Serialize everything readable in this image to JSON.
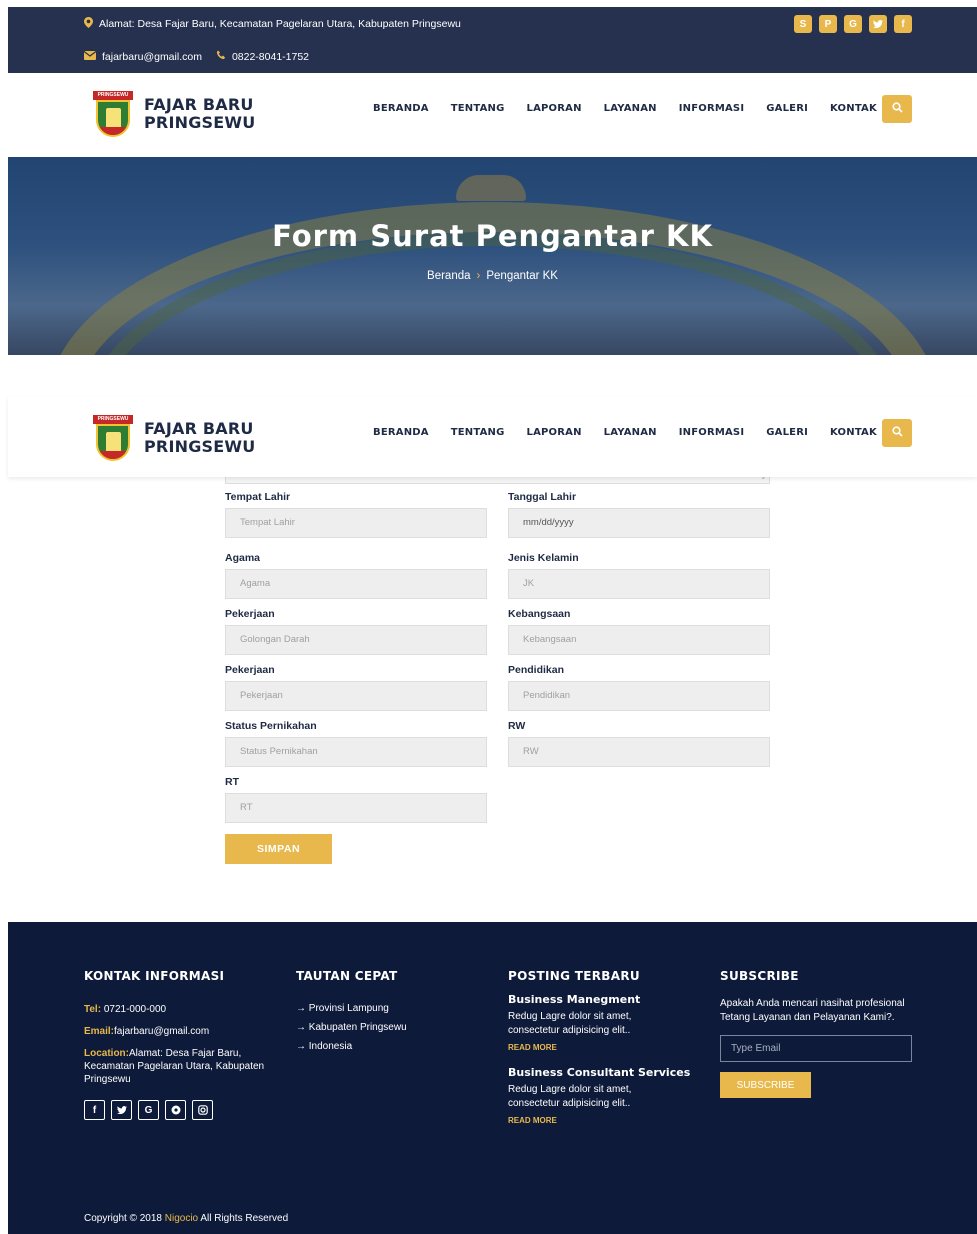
{
  "topbar": {
    "address": "Alamat: Desa Fajar Baru, Kecamatan Pagelaran Utara, Kabupaten Pringsewu",
    "email": "fajarbaru@gmail.com",
    "phone": "0822-8041-1752",
    "socials": [
      "skype-icon",
      "pinterest-icon",
      "google-icon",
      "twitter-icon",
      "facebook-icon"
    ]
  },
  "brand": {
    "line1": "FAJAR BARU",
    "line2": "PRINGSEWU",
    "emblem_text": "PRINGSEWU"
  },
  "nav": [
    "BERANDA",
    "TENTANG",
    "LAPORAN",
    "LAYANAN",
    "INFORMASI",
    "GALERI",
    "KONTAK"
  ],
  "hero": {
    "title": "Form Surat Pengantar KK",
    "crumb_home": "Beranda",
    "crumb_current": "Pengantar KK"
  },
  "form": {
    "fields": [
      {
        "label": "Tempat Lahir",
        "placeholder": "Tempat Lahir"
      },
      {
        "label": "Tanggal Lahir",
        "placeholder": "mm/dd/yyyy"
      },
      {
        "label": "Agama",
        "placeholder": "Agama"
      },
      {
        "label": "Jenis Kelamin",
        "placeholder": "JK"
      },
      {
        "label": "Pekerjaan",
        "placeholder": "Golongan Darah"
      },
      {
        "label": "Kebangsaan",
        "placeholder": "Kebangsaan"
      },
      {
        "label": "Pekerjaan",
        "placeholder": "Pekerjaan"
      },
      {
        "label": "Pendidikan",
        "placeholder": "Pendidikan"
      },
      {
        "label": "Status Pernikahan",
        "placeholder": "Status Pernikahan"
      },
      {
        "label": "RW",
        "placeholder": "RW"
      },
      {
        "label": "RT",
        "placeholder": "RT"
      }
    ],
    "submit": "SIMPAN"
  },
  "footer": {
    "contact": {
      "heading": "KONTAK INFORMASI",
      "tel_label": "Tel:",
      "tel": "0721-000-000",
      "email_label": "Email:",
      "email": "fajarbaru@gmail.com",
      "location_label": "Location:",
      "location": "Alamat: Desa Fajar Baru, Kecamatan Pagelaran Utara, Kabupaten Pringsewu"
    },
    "socials": [
      "facebook-icon",
      "twitter-icon",
      "google-icon",
      "pinterest-icon",
      "instagram-icon"
    ],
    "quick": {
      "heading": "TAUTAN CEPAT",
      "links": [
        "Provinsi Lampung",
        "Kabupaten Pringsewu",
        "Indonesia"
      ]
    },
    "posts": {
      "heading": "POSTING TERBARU",
      "items": [
        {
          "title": "Business Manegment",
          "text": "Redug Lagre dolor sit amet, consectetur adipisicing elit..",
          "more": "READ MORE"
        },
        {
          "title": "Business Consultant Services",
          "text": "Redug Lagre dolor sit amet, consectetur adipisicing elit..",
          "more": "READ MORE"
        }
      ]
    },
    "subscribe": {
      "heading": "SUBSCRIBE",
      "text": "Apakah Anda mencari nasihat profesional Tetang Layanan dan Pelayanan Kami?.",
      "placeholder": "Type Email",
      "button": "SUBSCRIBE"
    },
    "copyright_pre": "Copyright © 2018",
    "copyright_brand": "Nigocio",
    "copyright_post": "All Rights Reserved"
  }
}
